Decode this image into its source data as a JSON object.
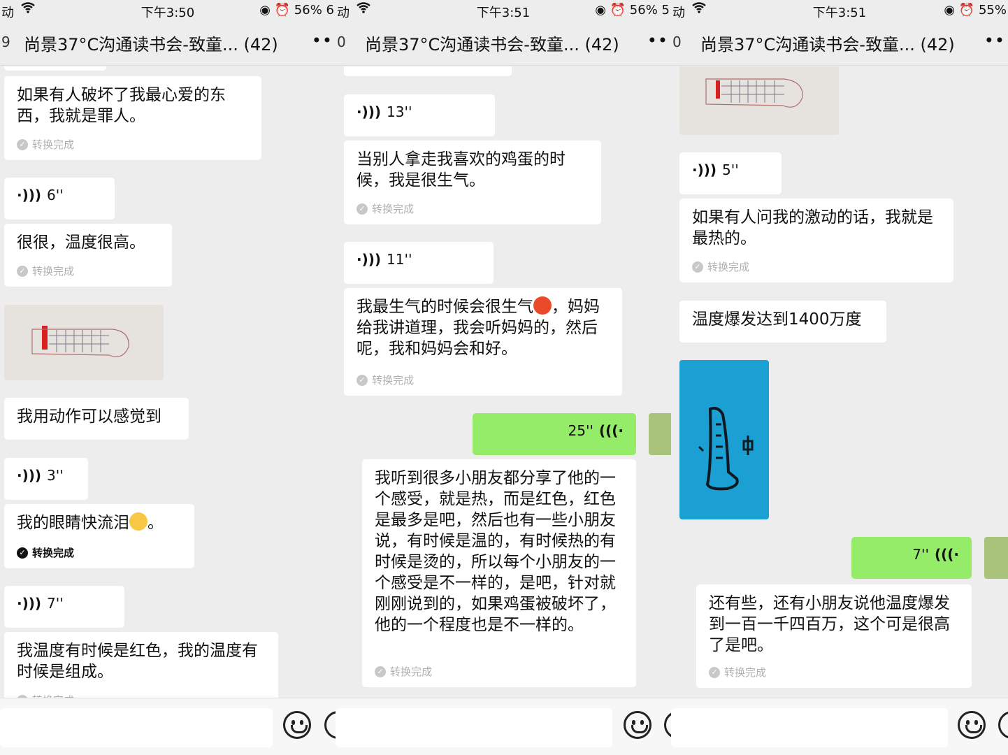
{
  "panels": [
    {
      "status_left": "动",
      "time": "下午3:50",
      "status_right": "◉ ⏰ 56% 6",
      "back": "9",
      "title": "尚景37°C沟通读书会-致童... (42)",
      "more": "••",
      "messages": {
        "m1": "如果有人破坏了我最心爱的东西，我就是罪人。",
        "v1": "6''",
        "m2": "很很，温度很高。",
        "m3": "我用动作可以感觉到",
        "v2": "3''",
        "m4a": "我的眼睛快流泪",
        "m4b": "。",
        "v3": "7''",
        "m5": "我温度有时候是红色，我的温度有时候是组成。"
      }
    },
    {
      "status_left": "动",
      "time": "下午3:51",
      "status_right": "◉ ⏰ 56% 5",
      "back": "0",
      "title": "尚景37°C沟通读书会-致童... (42)",
      "more": "••",
      "messages": {
        "v1": "13''",
        "m1": "当别人拿走我喜欢的鸡蛋的时候，我是很生气。",
        "v2": "11''",
        "m2a": "我最生气的时候会很生气",
        "m2b": "，妈妈给我讲道理，我会听妈妈的，然后呢，我和妈妈会和好。",
        "v3": "25''",
        "m3": "我听到很多小朋友都分享了他的一个感受，就是热，而是红色，红色是最多是吧，然后也有一些小朋友说，有时候是温的，有时候热的有时候是烫的，所以每个小朋友的一个感受是不一样的，是吧，针对就刚刚说到的，如果鸡蛋被破坏了，他的一个程度也是不一样的。"
      }
    },
    {
      "status_left": "动",
      "time": "下午3:51",
      "status_right": "◉ ⏰ 55%",
      "back": "0",
      "title": "尚景37°C沟通读书会-致童... (42)",
      "more": "••",
      "messages": {
        "v1": "5''",
        "m1": "如果有人问我的激动的话，我就是最热的。",
        "m2": "温度爆发达到1400万度",
        "v2": "7''",
        "m3": "还有些，还有小朋友说他温度爆发到一百一千四百万，这个可是很高了是吧。"
      }
    }
  ],
  "converted_label": "转换完成",
  "voice_icon": "🔊",
  "colors": {
    "sent_bubble": "#95ec69",
    "received_bubble": "#ffffff",
    "background": "#ededed"
  }
}
